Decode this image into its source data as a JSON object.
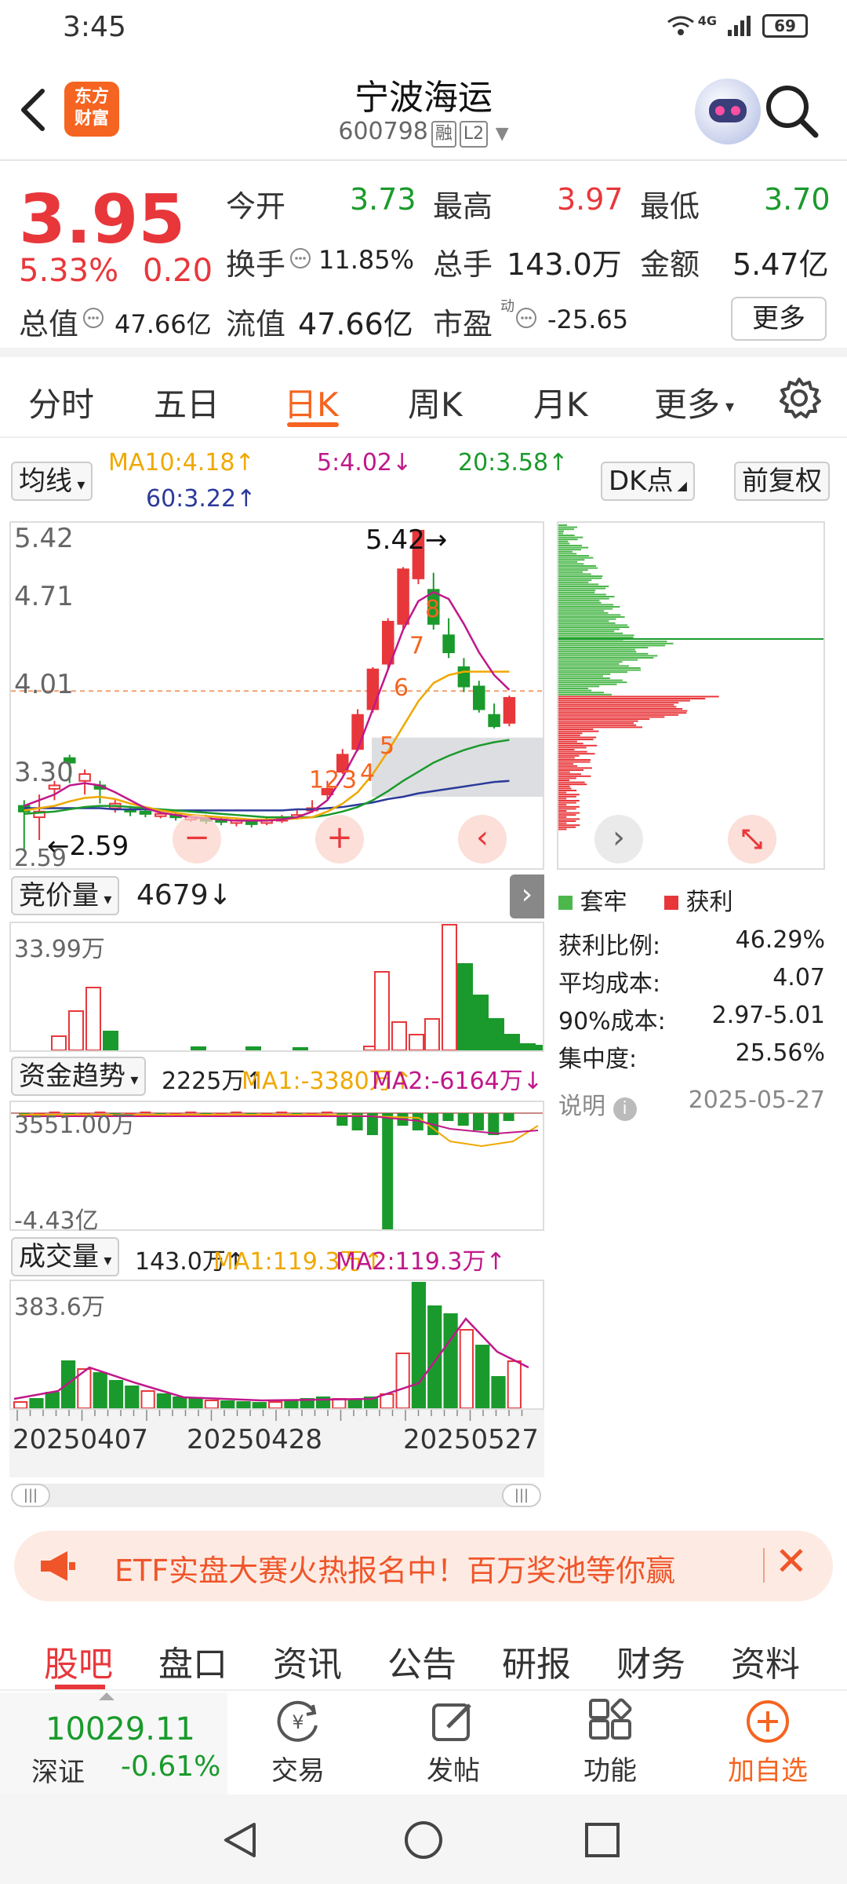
{
  "status": {
    "time": "3:45",
    "battery": "69",
    "network": "4G"
  },
  "header": {
    "stock_name": "宁波海运",
    "stock_code": "600798",
    "tag_rong": "融",
    "tag_l2": "L2",
    "logo_line1": "东方",
    "logo_line2": "财富"
  },
  "quote": {
    "price": "3.95",
    "change_pct": "5.33%",
    "change_amt": "0.20",
    "open_label": "今开",
    "open": "3.73",
    "high_label": "最高",
    "high": "3.97",
    "low_label": "最低",
    "low": "3.70",
    "turnover_label": "换手",
    "turnover": "11.85%",
    "volume_label": "总手",
    "volume": "143.0万",
    "amount_label": "金额",
    "amount": "5.47亿",
    "mcap_label": "总值",
    "mcap": "47.66亿",
    "float_label": "流值",
    "float_mcap": "47.66亿",
    "pe_label": "市盈",
    "pe_sup": "动",
    "pe": "-25.65",
    "more": "更多"
  },
  "tabs": [
    "分时",
    "五日",
    "日K",
    "周K",
    "月K",
    "更多"
  ],
  "ma": {
    "selector": "均线",
    "ma10": "MA10:4.18↑",
    "ma5": "5:4.02↓",
    "ma20": "20:3.58↑",
    "ma60": "60:3.22↑",
    "dk": "DK点",
    "fq": "前复权"
  },
  "kline": {
    "y_labels": [
      "5.42",
      "4.71",
      "4.01",
      "3.30",
      "2.59"
    ],
    "high_marker": "5.42",
    "low_marker": "2.59",
    "seq_labels": [
      "1",
      "2",
      "3",
      "4",
      "5",
      "6",
      "7",
      "8",
      "9"
    ],
    "dashed_level": 4.01,
    "colors": {
      "up": "#e8373b",
      "down": "#1a9a2c",
      "ma5": "#c0188a",
      "ma10": "#f0a800",
      "ma20": "#1a9a2c",
      "ma60": "#2b3a9a"
    }
  },
  "chips": {
    "legend_trapped": "套牢",
    "legend_profit": "获利",
    "stats": [
      {
        "label": "获利比例:",
        "value": "46.29%"
      },
      {
        "label": "平均成本:",
        "value": "4.07"
      },
      {
        "label": "90%成本:",
        "value": "2.97-5.01"
      },
      {
        "label": "集中度:",
        "value": "25.56%"
      }
    ],
    "note_label": "说明",
    "date": "2025-05-27"
  },
  "auction": {
    "selector": "竞价量",
    "value": "4679↓",
    "max_label": "33.99万"
  },
  "fund": {
    "selector": "资金趋势",
    "value": "2225万↑",
    "ma1": "MA1:-3380万↑",
    "ma2": "MA2:-6164万↓",
    "top_label": "3551.00万",
    "bottom_label": "-4.43亿"
  },
  "vol": {
    "selector": "成交量",
    "value": "143.0万↑",
    "ma1": "MA1:119.3万↑",
    "ma2": "MA2:119.3万↑",
    "max_label": "383.6万",
    "dates": [
      "20250407",
      "20250428",
      "20250527"
    ]
  },
  "banner": {
    "text": "ETF实盘大赛火热报名中！百万奖池等你赢"
  },
  "bottom_tabs": [
    "股吧",
    "盘口",
    "资讯",
    "公告",
    "研报",
    "财务",
    "资料"
  ],
  "toolbar": {
    "index_value": "10029.11",
    "index_name": "深证",
    "index_change": "-0.61%",
    "trade": "交易",
    "post": "发帖",
    "function": "功能",
    "add": "加自选"
  }
}
